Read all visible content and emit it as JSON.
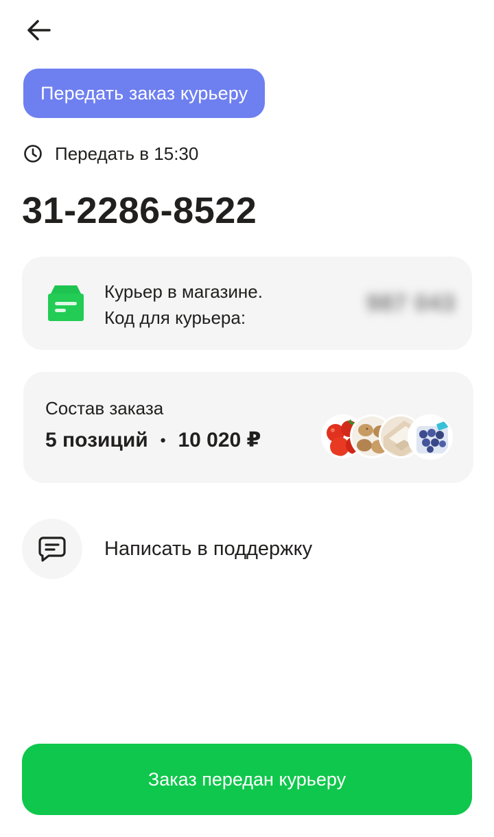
{
  "header": {
    "back_icon": "arrow-left-icon"
  },
  "status": {
    "label": "Передать заказ курьеру",
    "color": "#6e7ff0"
  },
  "handover": {
    "icon": "clock-icon",
    "text": "Передать в 15:30"
  },
  "order": {
    "number": "31-2286-8522"
  },
  "courier": {
    "icon": "box-icon",
    "icon_color": "#22cc55",
    "line1": "Курьер в магазине.",
    "line2": "Код для курьера:",
    "code": "987 043"
  },
  "composition": {
    "title": "Состав заказа",
    "items_count": "5 позиций",
    "separator": "•",
    "total": "10 020 ₽",
    "thumbnails": [
      "tomatoes-thumbnail",
      "potatoes-thumbnail",
      "package-thumbnail",
      "blueberries-thumbnail"
    ]
  },
  "support": {
    "icon": "chat-message-icon",
    "label": "Написать в поддержку"
  },
  "footer": {
    "button_label": "Заказ передан курьеру",
    "button_color": "#0fc74c"
  }
}
